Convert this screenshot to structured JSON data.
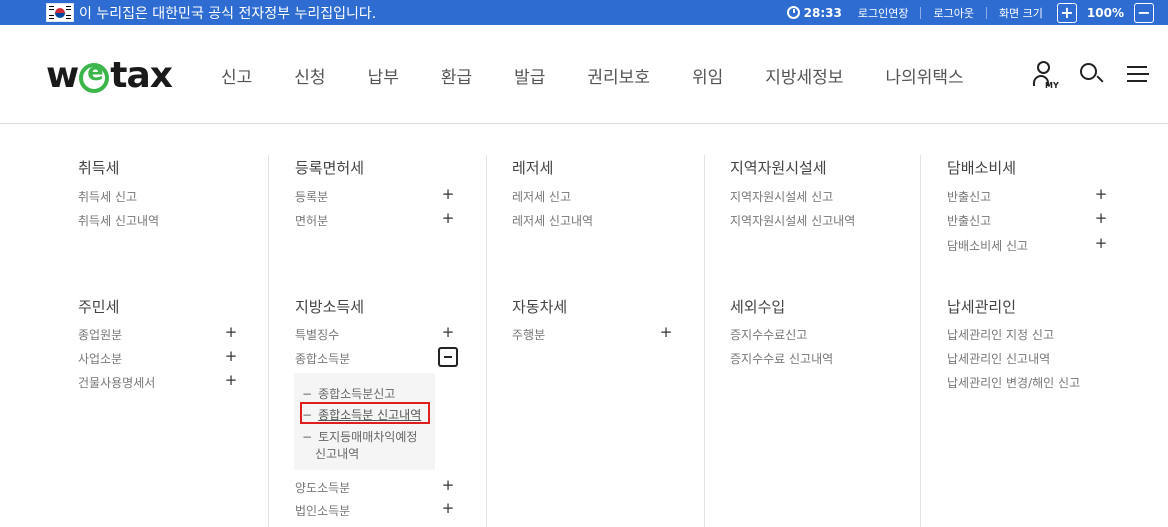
{
  "gov_bar": {
    "notice": "이 누리집은 대한민국 공식 전자정부 누리집입니다.",
    "timer": "28:33",
    "extend_login": "로그인연장",
    "logout": "로그아웃",
    "screen_size": "화면 크기",
    "zoom_in": "+",
    "zoom_level": "100%",
    "zoom_out": "−"
  },
  "header": {
    "logo": "wetax",
    "nav": [
      "신고",
      "신청",
      "납부",
      "환급",
      "발급",
      "권리보호",
      "위임",
      "지방세정보",
      "나의위택스"
    ],
    "my_label": "MY"
  },
  "sitemap": {
    "row1": [
      {
        "title": "취득세",
        "items": [
          {
            "label": "취득세 신고"
          },
          {
            "label": "취득세 신고내역"
          }
        ]
      },
      {
        "title": "등록면허세",
        "items": [
          {
            "label": "등록분",
            "plus": "+"
          },
          {
            "label": "면허분",
            "plus": "+"
          }
        ]
      },
      {
        "title": "레저세",
        "items": [
          {
            "label": "레저세 신고"
          },
          {
            "label": "레저세 신고내역"
          }
        ]
      },
      {
        "title": "지역자원시설세",
        "items": [
          {
            "label": "지역자원시설세 신고"
          },
          {
            "label": "지역자원시설세 신고내역"
          }
        ]
      },
      {
        "title": "담배소비세",
        "items": [
          {
            "label": "반출신고",
            "plus": "+"
          },
          {
            "label": "반출신고",
            "plus": "+"
          },
          {
            "label": "담배소비세 신고",
            "plus": "+"
          }
        ]
      }
    ],
    "row2": [
      {
        "title": "주민세",
        "items": [
          {
            "label": "종업원분",
            "plus": "+"
          },
          {
            "label": "사업소분",
            "plus": "+"
          },
          {
            "label": "건물사용명세서",
            "plus": "+"
          }
        ]
      },
      {
        "title": "지방소득세",
        "items": [
          {
            "label": "특별징수",
            "plus": "+"
          },
          {
            "label": "종합소득분"
          },
          {
            "label": "양도소득분",
            "plus": "+"
          },
          {
            "label": "법인소득분",
            "plus": "+"
          }
        ]
      },
      {
        "title": "자동차세",
        "items": [
          {
            "label": "주행분",
            "plus": "+"
          }
        ]
      },
      {
        "title": "세외수입",
        "items": [
          {
            "label": "증지수수료신고"
          },
          {
            "label": "증지수수료 신고내역"
          }
        ]
      },
      {
        "title": "납세관리인",
        "items": [
          {
            "label": "납세관리인 지정 신고"
          },
          {
            "label": "납세관리인 신고내역"
          },
          {
            "label": "납세관리인 변경/해인 신고"
          }
        ]
      }
    ],
    "sub_panel": {
      "dash": "−",
      "items": [
        "종합소득분신고",
        "종합소득분 신고내역",
        "토지등매매차익예정",
        "신고내역"
      ]
    }
  }
}
